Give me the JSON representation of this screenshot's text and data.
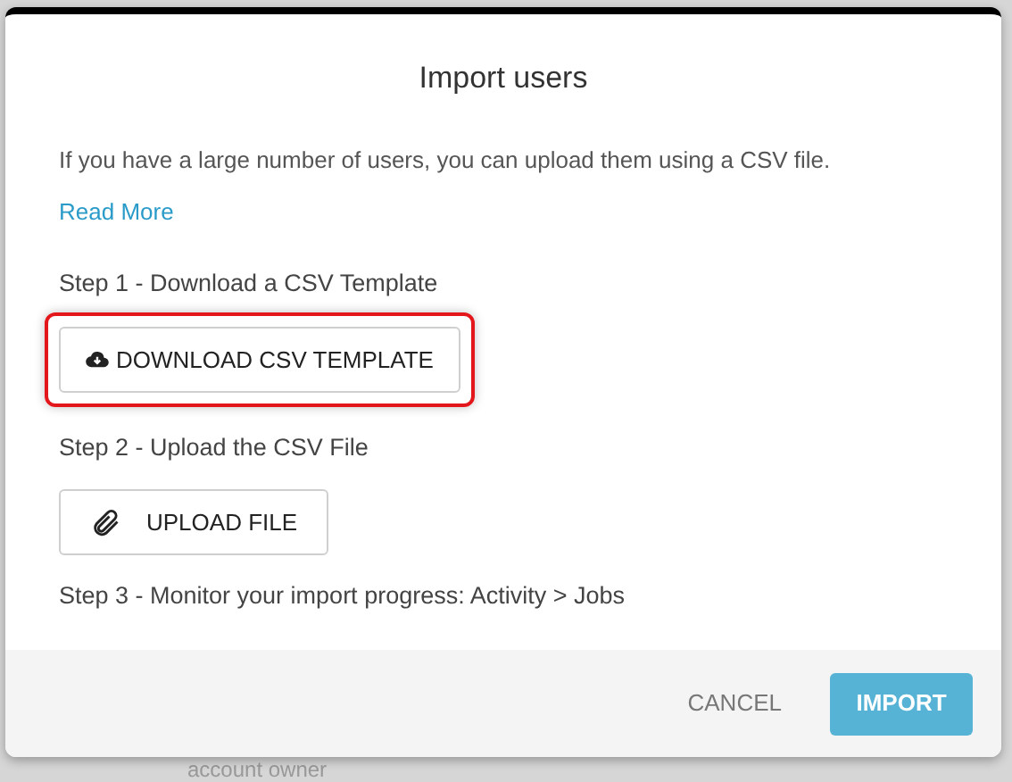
{
  "dialog": {
    "title": "Import users",
    "intro": "If you have a large number of users, you can upload them using a CSV file.",
    "read_more": "Read More",
    "steps": [
      {
        "kind": "download",
        "label": "Step 1 - Download a CSV Template",
        "button": "DOWNLOAD CSV TEMPLATE",
        "highlighted": true
      },
      {
        "kind": "upload",
        "label": "Step 2 - Upload the CSV File",
        "button": "UPLOAD FILE",
        "highlighted": false
      },
      {
        "kind": "text",
        "label": "Step 3 - Monitor your import progress: Activity > Jobs"
      }
    ],
    "buttons": {
      "cancel": "CANCEL",
      "import": "IMPORT"
    }
  },
  "background": {
    "text": "account owner"
  }
}
